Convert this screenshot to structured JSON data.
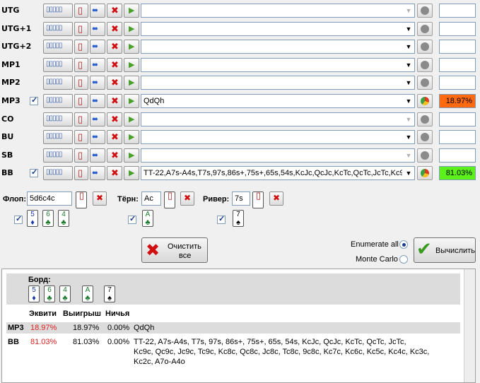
{
  "players": [
    {
      "pos": "UTG",
      "checked": false,
      "hand": "",
      "equity": "",
      "pie": false,
      "eq_color": "",
      "arrow_dim": true
    },
    {
      "pos": "UTG+1",
      "checked": false,
      "hand": "",
      "equity": "",
      "pie": false,
      "eq_color": "",
      "arrow_dim": false
    },
    {
      "pos": "UTG+2",
      "checked": false,
      "hand": "",
      "equity": "",
      "pie": false,
      "eq_color": "",
      "arrow_dim": false
    },
    {
      "pos": "MP1",
      "checked": false,
      "hand": "",
      "equity": "",
      "pie": false,
      "eq_color": "",
      "arrow_dim": false
    },
    {
      "pos": "MP2",
      "checked": false,
      "hand": "",
      "equity": "",
      "pie": false,
      "eq_color": "",
      "arrow_dim": false
    },
    {
      "pos": "MP3",
      "checked": true,
      "hand": "QdQh",
      "equity": "18.97%",
      "pie": true,
      "eq_color": "#ff6a10",
      "arrow_dim": false
    },
    {
      "pos": "CO",
      "checked": false,
      "hand": "",
      "equity": "",
      "pie": false,
      "eq_color": "",
      "arrow_dim": true
    },
    {
      "pos": "BU",
      "checked": false,
      "hand": "",
      "equity": "",
      "pie": false,
      "eq_color": "",
      "arrow_dim": false
    },
    {
      "pos": "SB",
      "checked": false,
      "hand": "",
      "equity": "",
      "pie": false,
      "eq_color": "",
      "arrow_dim": true
    },
    {
      "pos": "BB",
      "checked": true,
      "hand": "TT-22,A7s-A4s,T7s,97s,86s+,75s+,65s,54s,KcJc,QcJc,KcTc,QcTc,JcTc,Kc9c",
      "equity": "81.03%",
      "pie": true,
      "eq_color": "#5cf01c",
      "arrow_dim": false
    }
  ],
  "board": {
    "flop_label": "Флоп:",
    "flop_value": "5d6c4c",
    "turn_label": "Тёрн:",
    "turn_value": "Ac",
    "river_label": "Ривер:",
    "river_value": "7s",
    "flop_cards": [
      {
        "rank": "5",
        "suit": "♦",
        "color": "blue"
      },
      {
        "rank": "6",
        "suit": "♣",
        "color": "grn"
      },
      {
        "rank": "4",
        "suit": "♣",
        "color": "grn"
      }
    ],
    "turn_card": {
      "rank": "A",
      "suit": "♣",
      "color": "grn"
    },
    "river_card": {
      "rank": "7",
      "suit": "♠",
      "color": "blk"
    }
  },
  "controls": {
    "clear_label_1": "Очистить",
    "clear_label_2": "все",
    "enumerate_label": "Enumerate all",
    "monte_carlo_label": "Monte Carlo",
    "calculate_label": "Вычислить"
  },
  "results": {
    "board_label": "Борд:",
    "col_equity": "Эквити",
    "col_win": "Выигрыш",
    "col_tie": "Ничья",
    "rows": [
      {
        "pos": "MP3",
        "equity": "18.97%",
        "win": "18.97%",
        "tie": "0.00%",
        "hand": "QdQh"
      },
      {
        "pos": "BB",
        "equity": "81.03%",
        "win": "81.03%",
        "tie": "0.00%",
        "hand_lines": [
          "TT-22, A7s-A4s, T7s, 97s, 86s+, 75s+, 65s, 54s, KcJc, QcJc, KcTc, QcTc, JcTc,",
          "Kc9c, Qc9c, Jc9c, Tc9c, Kc8c, Qc8c, Jc8c, Tc8c, 9c8c, Kc7c, Kc6c, Kc5c, Kc4c, Kc3c,",
          "Kc2c, A7o-A4o"
        ]
      }
    ]
  }
}
